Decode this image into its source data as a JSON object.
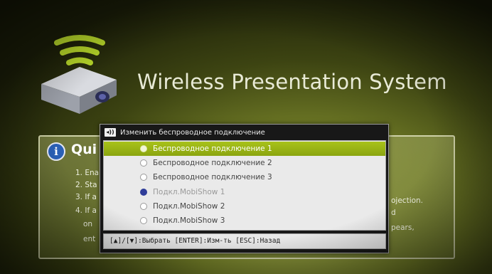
{
  "header": {
    "title": "Wireless Presentation System"
  },
  "quick_start": {
    "title": "Qui",
    "steps": [
      "1. Ena",
      "2. Sta",
      "3. If a",
      "4. If a",
      "on",
      "ent"
    ],
    "right_fragments": [
      "ojection.",
      "d",
      "pears,"
    ]
  },
  "dialog": {
    "title": "Изменить беспроводное подключение",
    "items": [
      {
        "label": "Беспроводное подключение 1",
        "state": "highlighted"
      },
      {
        "label": "Беспроводное подключение 2",
        "state": "normal"
      },
      {
        "label": "Беспроводное подключение 3",
        "state": "normal"
      },
      {
        "label": "Подкл.MobiShow 1",
        "state": "current"
      },
      {
        "label": "Подкл.MobiShow 2",
        "state": "normal"
      },
      {
        "label": "Подкл.MobiShow 3",
        "state": "normal"
      }
    ],
    "footer": "[▲]/[▼]:Выбрать [ENTER]:Изм-ть [ESC]:Назад"
  },
  "icons": {
    "logo": "wireless-projector-icon",
    "info": "info-icon",
    "dialog_title": "wireless-signal-icon"
  },
  "colors": {
    "highlight": "#9db618",
    "accent_green": "#b5d52a",
    "selected_radio": "#2f3d99"
  }
}
